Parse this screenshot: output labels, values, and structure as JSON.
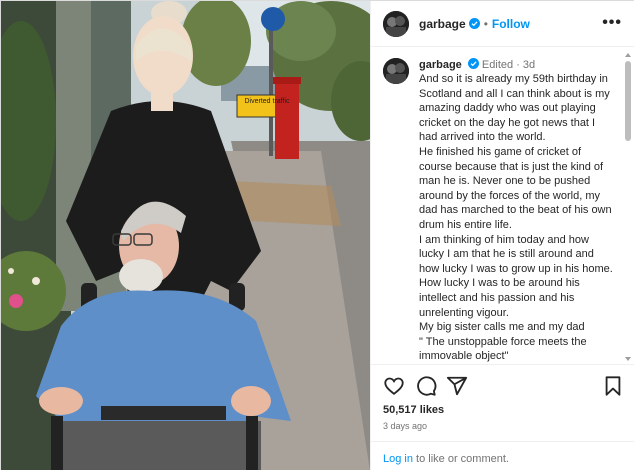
{
  "header": {
    "username": "garbage",
    "follow_label": "Follow",
    "separator": "•",
    "more_label": "•••"
  },
  "caption": {
    "username": "garbage",
    "edited": "Edited",
    "separator": "·",
    "time": "3d",
    "text": "And so it is already my 59th birthday in Scotland and all I can think about is my amazing daddy who was out playing cricket on the day he got news that I had arrived into the world.\nHe finished his game of cricket of course because that is just the kind of man he is. Never one to be pushed around by the forces of the world, my dad has marched to the beat of his own drum his entire life.\nI am thinking of him today and how lucky I am that he is still around and how lucky I was to grow up in his home. How lucky I was to be around his intellect and his passion and his unrelenting vigour.\nMy big sister calls me and my dad\n \" The unstoppable force meets the immovable object\"\nand I can't think of a more apt"
  },
  "photo": {
    "sign_text": "Diverted traffic"
  },
  "actions": {
    "likes": "50,517 likes",
    "time_ago": "3 days ago"
  },
  "login": {
    "link": "Log in",
    "rest": " to like or comment."
  },
  "icons": {
    "like": "heart-icon",
    "comment": "comment-icon",
    "share": "share-icon",
    "save": "bookmark-icon",
    "verified": "verified-badge-icon",
    "more": "more-options-icon"
  },
  "colors": {
    "accent": "#0095f6",
    "text": "#262626",
    "muted": "#737373",
    "border": "#efefef"
  }
}
